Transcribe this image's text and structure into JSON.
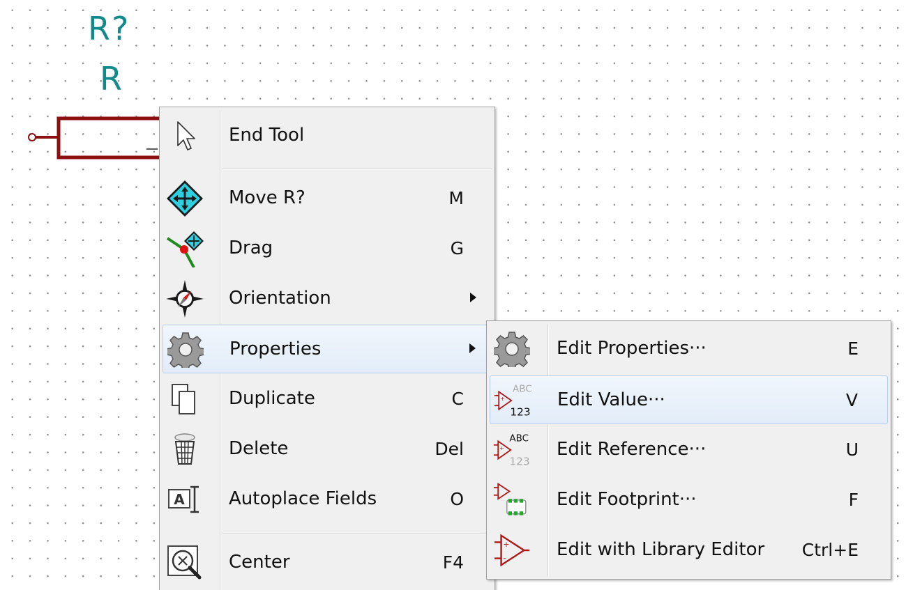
{
  "canvas": {
    "reference_designator": "R?",
    "value_label": "R",
    "component_color": "#8b1010",
    "field_color": "#13898c"
  },
  "context_menu": {
    "items": [
      {
        "label": "End Tool",
        "shortcut": "",
        "icon": "arrow-cursor-icon"
      },
      {
        "label": "Move R?",
        "shortcut": "M",
        "icon": "move-icon"
      },
      {
        "label": "Drag",
        "shortcut": "G",
        "icon": "drag-icon"
      },
      {
        "label": "Orientation",
        "shortcut": "",
        "icon": "compass-icon"
      },
      {
        "label": "Properties",
        "shortcut": "",
        "icon": "gear-icon"
      },
      {
        "label": "Duplicate",
        "shortcut": "C",
        "icon": "duplicate-icon"
      },
      {
        "label": "Delete",
        "shortcut": "Del",
        "icon": "trash-icon"
      },
      {
        "label": "Autoplace Fields",
        "shortcut": "O",
        "icon": "autoplace-icon"
      },
      {
        "label": "Center",
        "shortcut": "F4",
        "icon": "zoom-center-icon"
      }
    ]
  },
  "properties_submenu": {
    "items": [
      {
        "label": "Edit Properties···",
        "shortcut": "E",
        "icon": "gear-icon"
      },
      {
        "label": "Edit Value···",
        "shortcut": "V",
        "icon": "edit-value-icon"
      },
      {
        "label": "Edit Reference···",
        "shortcut": "U",
        "icon": "edit-reference-icon"
      },
      {
        "label": "Edit Footprint···",
        "shortcut": "F",
        "icon": "edit-footprint-icon"
      },
      {
        "label": "Edit with Library Editor",
        "shortcut": "Ctrl+E",
        "icon": "library-editor-icon"
      }
    ],
    "icon_text": {
      "abc": "ABC",
      "num": "123"
    }
  },
  "theme": {
    "menu_bg": "#f0f0f0",
    "hover_border": "#b4cfee",
    "hover_bg": "#e6eef9"
  }
}
